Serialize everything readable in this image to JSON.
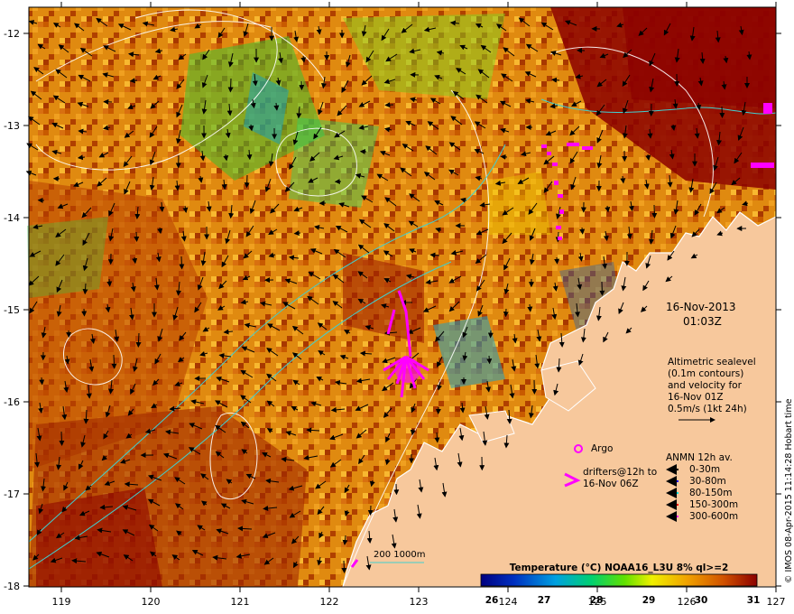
{
  "map": {
    "x_ticks": [
      "119",
      "120",
      "121",
      "122",
      "123",
      "124",
      "125",
      "126",
      "127"
    ],
    "y_ticks": [
      "-12",
      "-13",
      "-14",
      "-15",
      "-16",
      "-17",
      "-18"
    ],
    "date": "16-Nov-2013",
    "time": "01:03Z",
    "altimetry_lines": [
      "Altimetric sealevel",
      "(0.1m contours)",
      "and velocity for",
      "16-Nov 01Z",
      "0.5m/s (1kt 24h)"
    ],
    "argo_label": "Argo",
    "drifters_lines": [
      "drifters@12h to",
      "16-Nov 06Z"
    ],
    "anmn_title": "ANMN 12h av.",
    "anmn_items": [
      {
        "label": "0-30m",
        "color": "#000000"
      },
      {
        "label": "30-80m",
        "color": "#0000ff"
      },
      {
        "label": "80-150m",
        "color": "#00e0e0"
      },
      {
        "label": "150-300m",
        "color": "#ff0000"
      },
      {
        "label": "300-600m",
        "color": "#ff00ff"
      }
    ],
    "isobath_label": "200  1000m",
    "colorbar_title": "Temperature (°C) NOAA16_L3U 8% ql>=2",
    "colorbar_ticks": [
      "26",
      "27",
      "28",
      "29",
      "30",
      "31"
    ],
    "credit": "© IMOS 08-Apr-2015 11:14:28 Hobart time",
    "colors": {
      "land": "#f7c89c",
      "argo": "#ff00ff",
      "drifter": "#ff00ff"
    }
  }
}
